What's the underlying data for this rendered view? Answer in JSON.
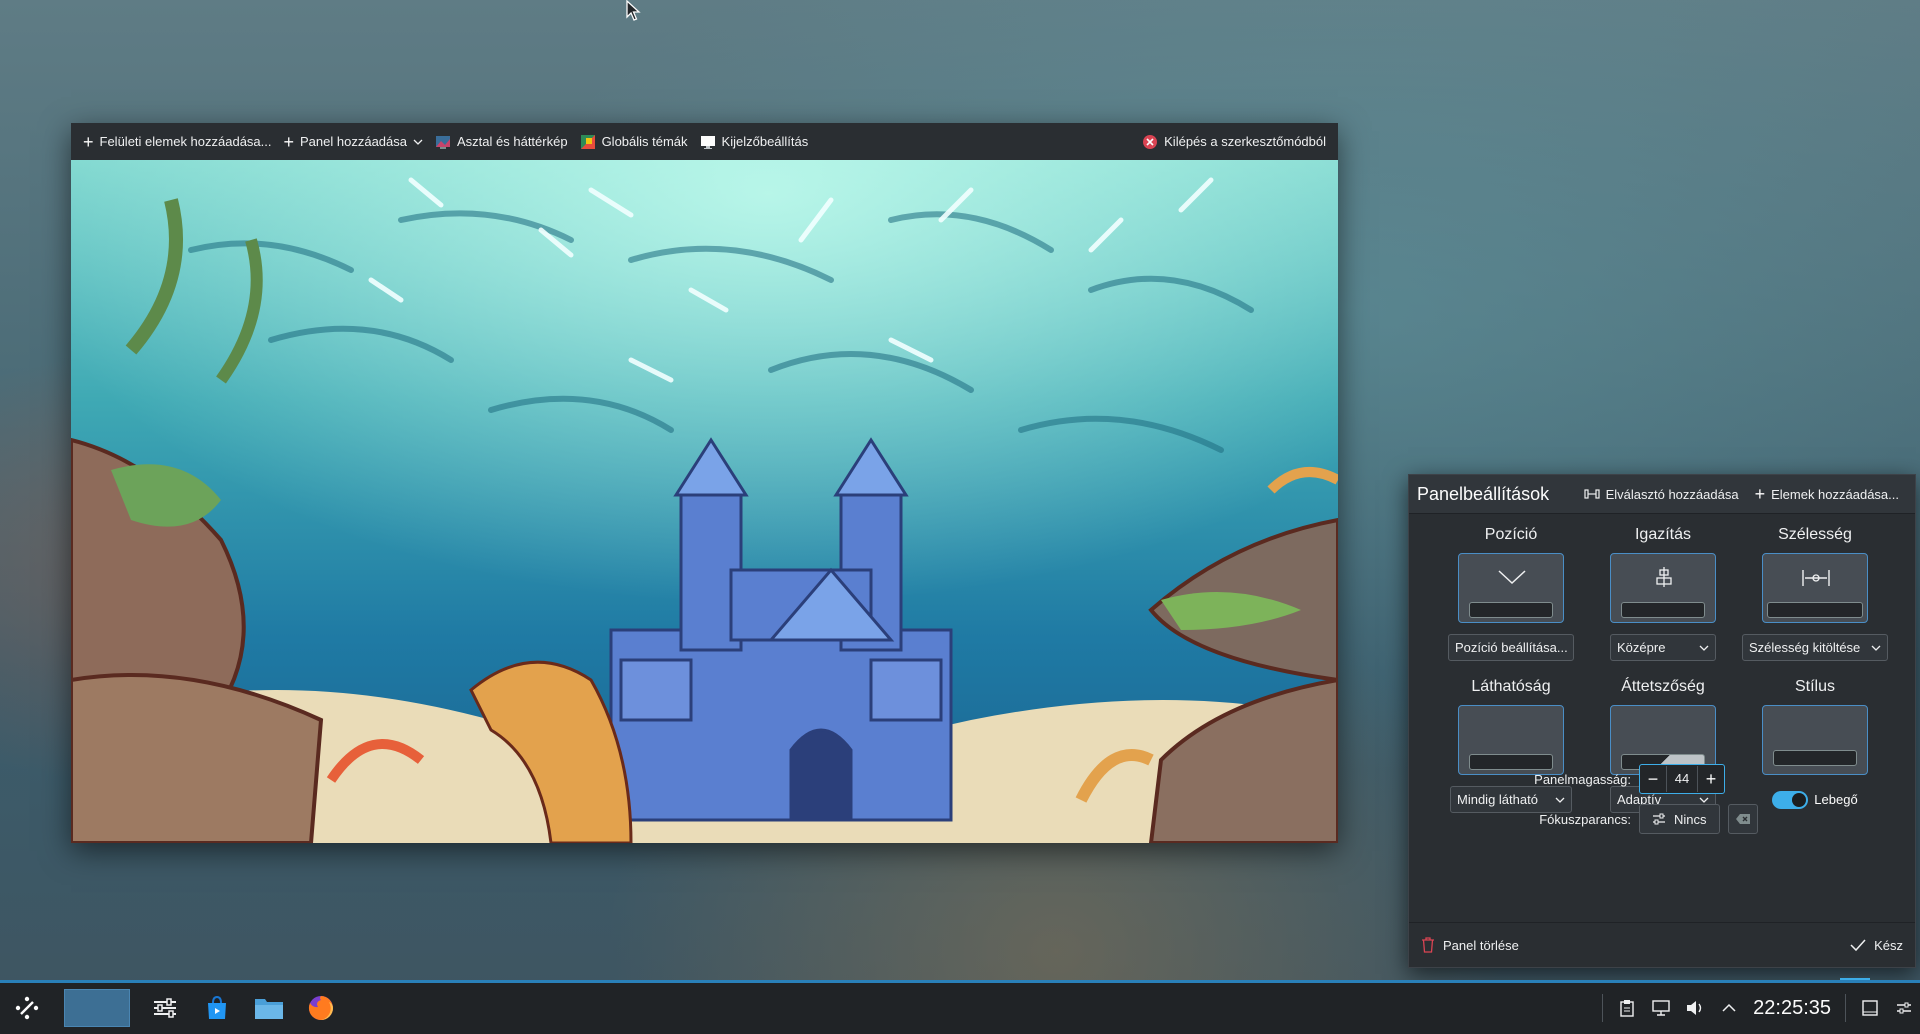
{
  "edit_toolbar": {
    "add_widgets": "Felületi elemek hozzáadása...",
    "add_panel": "Panel hozzáadása",
    "desktop_wallpaper": "Asztal és háttérkép",
    "global_themes": "Globális témák",
    "display_settings": "Kijelzőbeállítás",
    "exit_edit_mode": "Kilépés a szerkesztőmódból"
  },
  "panel_settings": {
    "title": "Panelbeállítások",
    "add_spacer": "Elválasztó hozzáadása",
    "add_widgets": "Elemek hozzáadása...",
    "position": {
      "label": "Pozíció",
      "value": "Pozíció beállítása..."
    },
    "alignment": {
      "label": "Igazítás",
      "value": "Középre"
    },
    "width": {
      "label": "Szélesség",
      "value": "Szélesség kitöltése"
    },
    "visibility": {
      "label": "Láthatóság",
      "value": "Mindig látható"
    },
    "opacity": {
      "label": "Áttetszőség",
      "value": "Adaptív"
    },
    "style": {
      "label": "Stílus",
      "toggle_label": "Lebegő",
      "toggle_on": true
    },
    "panel_height": {
      "label": "Panelmagasság:",
      "value": "44"
    },
    "focus_shortcut": {
      "label": "Fókuszparancs:",
      "value": "Nincs"
    },
    "delete_panel": "Panel törlése",
    "done": "Kész"
  },
  "taskbar": {
    "clock": "22:25:35",
    "apps": [
      "application-launcher-icon",
      "system-settings-icon",
      "discover-icon",
      "dolphin-icon",
      "firefox-icon"
    ]
  },
  "colors": {
    "accent": "#3daee9",
    "panel_bg": "#2a2e32",
    "taskbar_bg": "#202326",
    "danger": "#da4453"
  }
}
